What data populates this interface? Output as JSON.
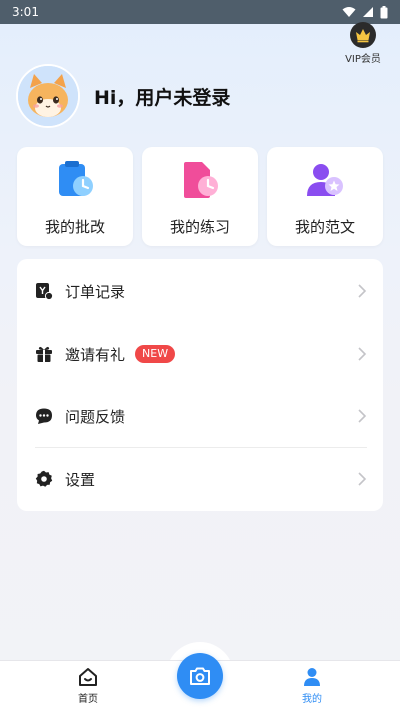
{
  "status_bar": {
    "time": "3:01"
  },
  "vip": {
    "label": "VIP会员",
    "icon": "crown-icon"
  },
  "profile": {
    "greeting": "Hi，用户未登录"
  },
  "cards": [
    {
      "label": "我的批改",
      "icon": "clipboard-clock-icon",
      "color": "#2f8df4"
    },
    {
      "label": "我的练习",
      "icon": "document-clock-icon",
      "color": "#f04d9a"
    },
    {
      "label": "我的范文",
      "icon": "user-star-icon",
      "color": "#8a4df0"
    }
  ],
  "menu": [
    {
      "label": "订单记录",
      "icon": "order-icon"
    },
    {
      "label": "邀请有礼",
      "icon": "gift-icon",
      "badge": "NEW"
    },
    {
      "label": "问题反馈",
      "icon": "chat-icon"
    },
    {
      "label": "设置",
      "icon": "gear-icon"
    }
  ],
  "tabbar": {
    "home_label": "首页",
    "mine_label": "我的",
    "active_color": "#2f8df4"
  }
}
